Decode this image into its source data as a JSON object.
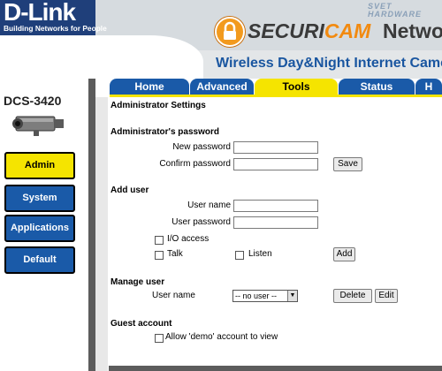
{
  "header": {
    "logo": "D-Link",
    "tagline": "Building Networks for People",
    "watermark_line1": "SVET",
    "watermark_line2": "HARDWARE",
    "brand_part1": "SECURI",
    "brand_part2": "CAM",
    "brand_part3": "Network",
    "subtitle": "Wireless Day&Night Internet Camera"
  },
  "tabs": [
    {
      "label": "Home"
    },
    {
      "label": "Advanced"
    },
    {
      "label": "Tools",
      "active": true
    },
    {
      "label": "Status"
    },
    {
      "label": "H"
    }
  ],
  "sidebar": {
    "model": "DCS-3420",
    "items": [
      {
        "label": "Admin",
        "active": true
      },
      {
        "label": "System"
      },
      {
        "label": "Applications"
      },
      {
        "label": "Default"
      }
    ]
  },
  "main": {
    "page_title": "Administrator Settings",
    "admin_password": {
      "heading": "Administrator's password",
      "new_label": "New password",
      "new_value": "",
      "confirm_label": "Confirm password",
      "confirm_value": "",
      "save_label": "Save"
    },
    "add_user": {
      "heading": "Add user",
      "username_label": "User name",
      "username_value": "",
      "password_label": "User password",
      "password_value": "",
      "io_label": "I/O access",
      "talk_label": "Talk",
      "listen_label": "Listen",
      "add_label": "Add"
    },
    "manage_user": {
      "heading": "Manage user",
      "username_label": "User name",
      "select_value": "-- no user --",
      "delete_label": "Delete",
      "edit_label": "Edit"
    },
    "guest": {
      "heading": "Guest account",
      "allow_label": "Allow 'demo' account to view"
    }
  },
  "colors": {
    "tab_blue": "#1a5aa8",
    "tab_active": "#f5e400",
    "brand_orange": "#f28a10",
    "subtitle_blue": "#1a56a0"
  }
}
